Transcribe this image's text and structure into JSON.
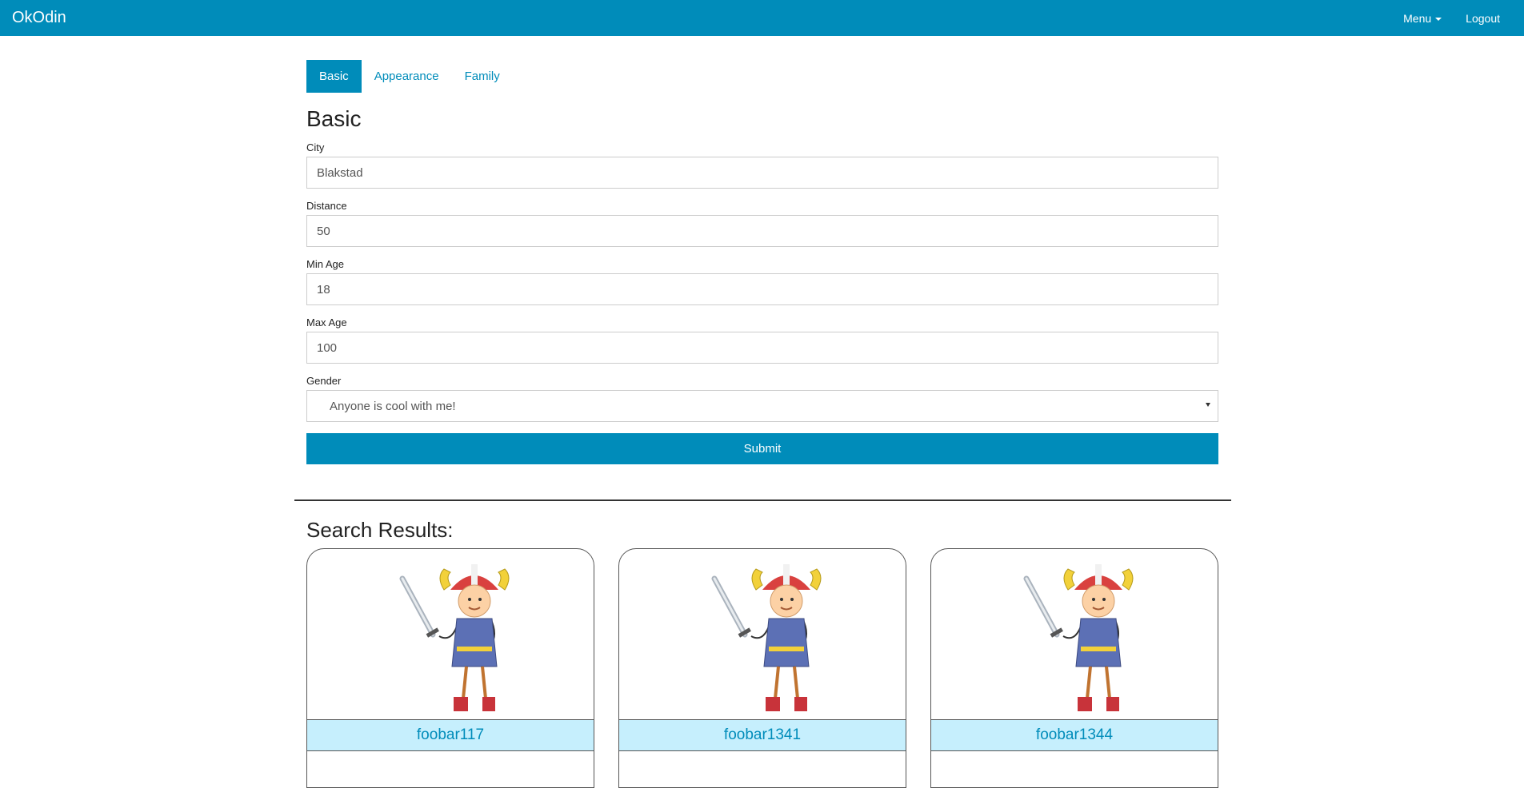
{
  "nav": {
    "brand": "OkOdin",
    "menu_label": "Menu",
    "logout_label": "Logout"
  },
  "tabs": [
    {
      "label": "Basic",
      "active": true
    },
    {
      "label": "Appearance",
      "active": false
    },
    {
      "label": "Family",
      "active": false
    }
  ],
  "form": {
    "title": "Basic",
    "city": {
      "label": "City",
      "value": "Blakstad"
    },
    "distance": {
      "label": "Distance",
      "value": "50"
    },
    "min_age": {
      "label": "Min Age",
      "value": "18"
    },
    "max_age": {
      "label": "Max Age",
      "value": "100"
    },
    "gender": {
      "label": "Gender",
      "value": "Anyone is cool with me!"
    },
    "submit_label": "Submit"
  },
  "results": {
    "title": "Search Results:",
    "items": [
      {
        "username": "foobar117",
        "image": "viking-avatar"
      },
      {
        "username": "foobar1341",
        "image": "viking-avatar"
      },
      {
        "username": "foobar1344",
        "image": "viking-avatar"
      }
    ]
  },
  "colors": {
    "primary": "#008cba",
    "name_bar": "#c6effd"
  }
}
